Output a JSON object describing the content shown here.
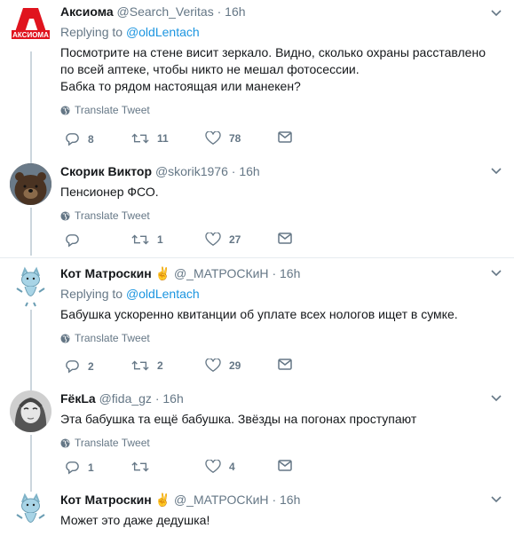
{
  "tweets": [
    {
      "name": "Аксиома",
      "handle": "@Search_Veritas",
      "time": "16h",
      "replying_label": "Replying to",
      "replying_to": "@oldLentach",
      "text_lines": [
        "Посмотрите на стене висит зеркало. Видно, сколько охраны расставлено",
        "по всей аптеке, чтобы никто не мешал фотосессии.",
        "Бабка то рядом настоящая или манекен?"
      ],
      "translate": "Translate Tweet",
      "replies": "8",
      "retweets": "11",
      "likes": "78",
      "avatar_text": "АКСИОМА"
    },
    {
      "name": "Скорик Виктор",
      "handle": "@skorik1976",
      "time": "16h",
      "text_lines": [
        "Пенсионер ФСО."
      ],
      "translate": "Translate Tweet",
      "replies": "",
      "retweets": "1",
      "likes": "27"
    },
    {
      "name": "Кот Матроскин",
      "emoji": "✌",
      "handle": "@_МАТРОСКиН",
      "time": "16h",
      "replying_label": "Replying to",
      "replying_to": "@oldLentach",
      "text_lines": [
        "Бабушка ускоренно квитанции об уплате всех нологов ищет в сумке."
      ],
      "translate": "Translate Tweet",
      "replies": "2",
      "retweets": "2",
      "likes": "29"
    },
    {
      "name": "FёкLa",
      "handle": "@fida_gz",
      "time": "16h",
      "text_lines": [
        "Эта бабушка та ещё бабушка. Звёзды на погонах проступают"
      ],
      "translate": "Translate Tweet",
      "replies": "1",
      "retweets": "",
      "likes": "4"
    },
    {
      "name": "Кот Матроскин",
      "emoji": "✌",
      "handle": "@_МАТРОСКиН",
      "time": "16h",
      "text_lines": [
        "Может это даже дедушка!"
      ]
    }
  ],
  "separator": "·",
  "colors": {
    "accent": "#1b95e0",
    "muted": "#657786",
    "line": "#ccd6dd",
    "brand_red": "#e0141e"
  }
}
